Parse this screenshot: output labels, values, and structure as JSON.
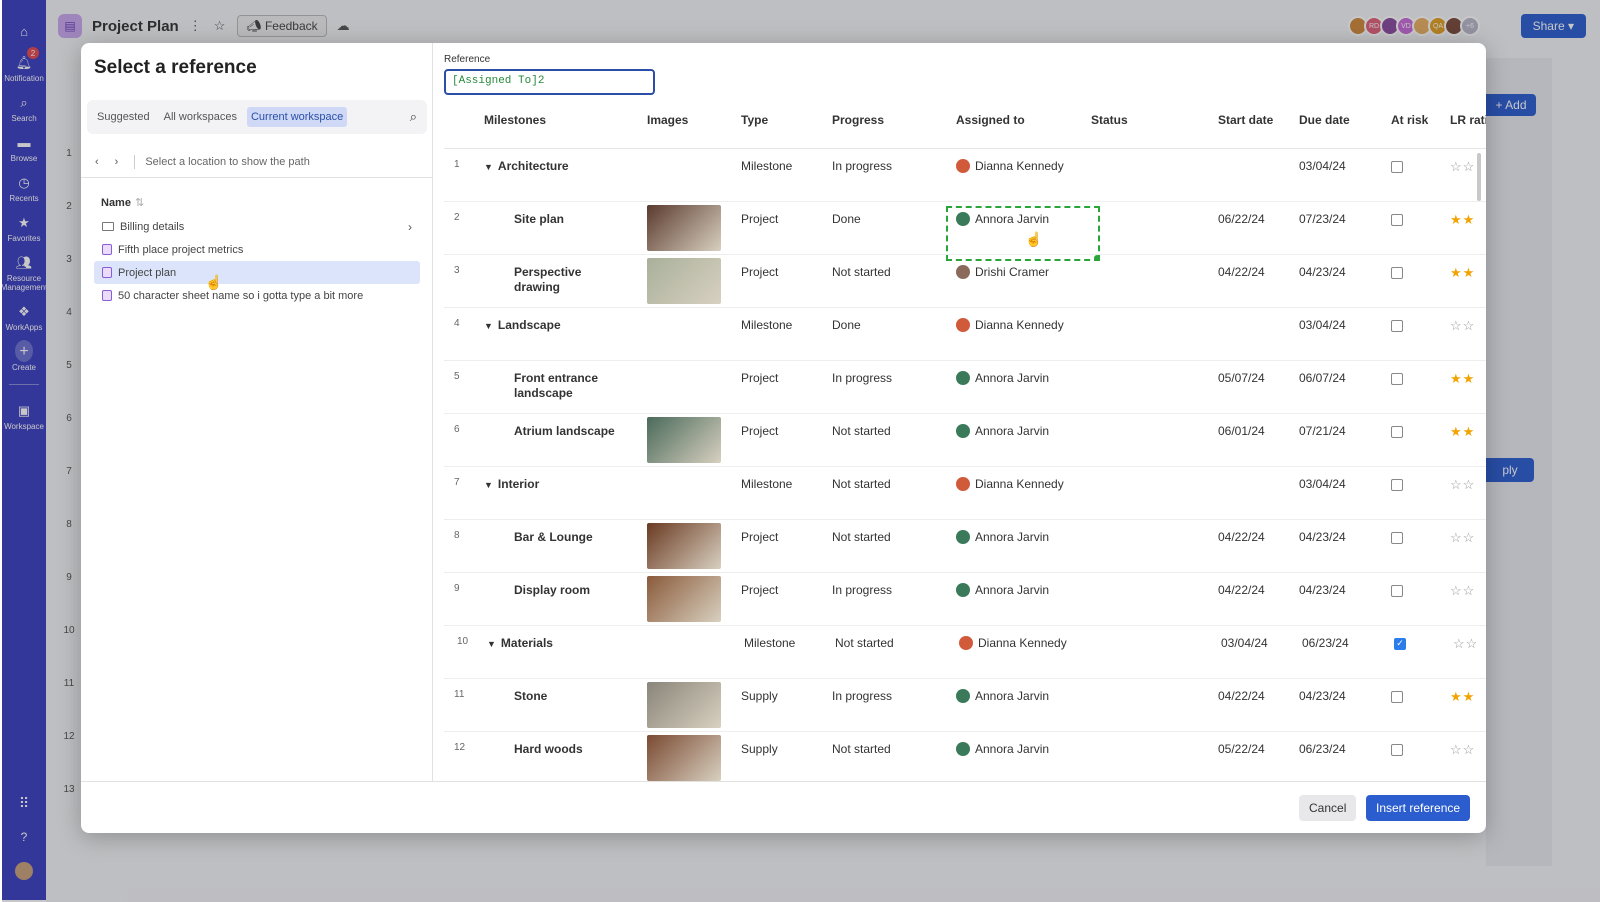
{
  "rail": {
    "notification_badge": "2",
    "items": [
      {
        "label": "Notification"
      },
      {
        "label": "Search"
      },
      {
        "label": "Browse"
      },
      {
        "label": "Recents"
      },
      {
        "label": "Favorites"
      },
      {
        "label": "Resource Management"
      },
      {
        "label": "WorkApps"
      },
      {
        "label": "Create"
      },
      {
        "label": "Workspace"
      }
    ]
  },
  "app": {
    "sheet_title": "Project Plan",
    "feedback_label": "Feedback",
    "share_label": "Share",
    "add_label": "+ Add",
    "apply_label": "ply",
    "row_numbers": [
      "1",
      "2",
      "3",
      "4",
      "5",
      "6",
      "7",
      "8",
      "9",
      "10",
      "11",
      "12",
      "13"
    ],
    "avatars": [
      {
        "initials": "",
        "color": "#d08a3a"
      },
      {
        "initials": "RD",
        "color": "#e0607a"
      },
      {
        "initials": "",
        "color": "#8a4b9e"
      },
      {
        "initials": "VD",
        "color": "#c86bd8"
      },
      {
        "initials": "",
        "color": "#e8b062"
      },
      {
        "initials": "QA",
        "color": "#e0a020"
      },
      {
        "initials": "",
        "color": "#7a4a3a"
      },
      {
        "initials": "+6",
        "color": "#b8b8c8"
      }
    ]
  },
  "modal": {
    "title": "Select a reference",
    "scope_tabs": [
      "Suggested",
      "All workspaces",
      "Current workspace"
    ],
    "active_scope": "Current workspace",
    "path_hint": "Select a location to show the path",
    "name_header": "Name",
    "files": [
      {
        "name": "Billing details",
        "kind": "folder"
      },
      {
        "name": "Fifth place project metrics",
        "kind": "sheet"
      },
      {
        "name": "Project plan",
        "kind": "sheet",
        "selected": true
      },
      {
        "name": "50 character sheet name so i gotta type a bit more",
        "kind": "sheet"
      }
    ],
    "reference_label": "Reference",
    "reference_value": "[Assigned To]2",
    "columns": [
      "Milestones",
      "Images",
      "Type",
      "Progress",
      "Assigned to",
      "Status",
      "Start date",
      "Due date",
      "At risk",
      "LR rati"
    ],
    "rows": [
      {
        "num": "1",
        "name": "Architecture",
        "level": 0,
        "image": "",
        "type": "Milestone",
        "progress": "In progress",
        "assigned": "Dianna Kennedy",
        "start": "",
        "due": "03/04/24",
        "at_risk": false,
        "stars": 0
      },
      {
        "num": "2",
        "name": "Site plan",
        "level": 1,
        "image": "#5a3a2e",
        "type": "Project",
        "progress": "Done",
        "assigned": "Annora Jarvin",
        "start": "06/22/24",
        "due": "07/23/24",
        "at_risk": false,
        "stars": 2
      },
      {
        "num": "3",
        "name": "Perspective drawing",
        "level": 1,
        "image": "#a8b09a",
        "type": "Project",
        "progress": "Not started",
        "assigned": "Drishi Cramer",
        "start": "04/22/24",
        "due": "04/23/24",
        "at_risk": false,
        "stars": 2
      },
      {
        "num": "4",
        "name": "Landscape",
        "level": 0,
        "image": "",
        "type": "Milestone",
        "progress": "Done",
        "assigned": "Dianna Kennedy",
        "start": "",
        "due": "03/04/24",
        "at_risk": false,
        "stars": 0
      },
      {
        "num": "5",
        "name": "Front entrance landscape",
        "level": 1,
        "image": "",
        "type": "Project",
        "progress": "In progress",
        "assigned": "Annora Jarvin",
        "start": "05/07/24",
        "due": "06/07/24",
        "at_risk": false,
        "stars": 2
      },
      {
        "num": "6",
        "name": "Atrium landscape",
        "level": 1,
        "image": "#4a6a5a",
        "type": "Project",
        "progress": "Not started",
        "assigned": "Annora Jarvin",
        "start": "06/01/24",
        "due": "07/21/24",
        "at_risk": false,
        "stars": 2
      },
      {
        "num": "7",
        "name": "Interior",
        "level": 0,
        "image": "",
        "type": "Milestone",
        "progress": "Not started",
        "assigned": "Dianna Kennedy",
        "start": "",
        "due": "03/04/24",
        "at_risk": false,
        "stars": 0
      },
      {
        "num": "8",
        "name": "Bar & Lounge",
        "level": 1,
        "image": "#6a3a22",
        "type": "Project",
        "progress": "Not started",
        "assigned": "Annora Jarvin",
        "start": "04/22/24",
        "due": "04/23/24",
        "at_risk": false,
        "stars": 0
      },
      {
        "num": "9",
        "name": "Display room",
        "level": 1,
        "image": "#8a5a3a",
        "type": "Project",
        "progress": "In progress",
        "assigned": "Annora Jarvin",
        "start": "04/22/24",
        "due": "04/23/24",
        "at_risk": false,
        "stars": 0
      },
      {
        "num": "10",
        "name": "Materials",
        "level": 0,
        "image": "",
        "type": "Milestone",
        "progress": "Not started",
        "assigned": "Dianna Kennedy",
        "start": "03/04/24",
        "due": "06/23/24",
        "at_risk": true,
        "stars": 0
      },
      {
        "num": "11",
        "name": "Stone",
        "level": 1,
        "image": "#8a857a",
        "type": "Supply",
        "progress": "In progress",
        "assigned": "Annora Jarvin",
        "start": "04/22/24",
        "due": "04/23/24",
        "at_risk": false,
        "stars": 2
      },
      {
        "num": "12",
        "name": "Hard woods",
        "level": 1,
        "image": "#7a4a32",
        "type": "Supply",
        "progress": "Not started",
        "assigned": "Annora Jarvin",
        "start": "05/22/24",
        "due": "06/23/24",
        "at_risk": false,
        "stars": 0
      }
    ],
    "cancel_label": "Cancel",
    "insert_label": "Insert reference"
  }
}
